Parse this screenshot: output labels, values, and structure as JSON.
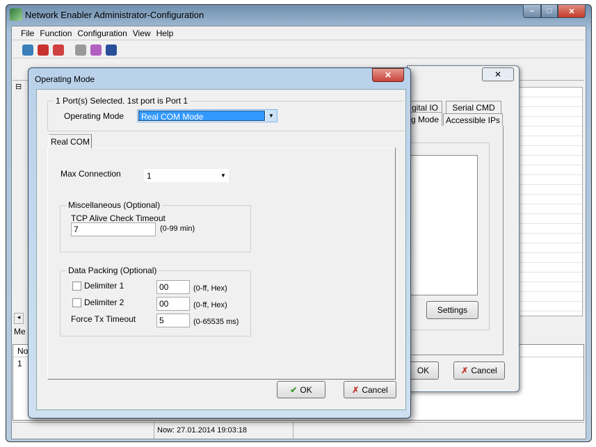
{
  "main_window": {
    "title": "Network Enabler Administrator-Configuration",
    "menu": [
      "File",
      "Function",
      "Configuration",
      "View",
      "Help"
    ],
    "toolbar_icons": [
      "broadcast-search-icon",
      "search-ip-icon",
      "unlock-icon",
      "monitor-icon",
      "book-icon",
      "exit-icon"
    ],
    "tree_toggle": "⊟",
    "bottom_tab": "Me",
    "bottom_header": "No",
    "bottom_row": "1",
    "status": "Now: 27.01.2014 19:03:18"
  },
  "background_dialog": {
    "tabs": [
      "gital IO",
      "Serial CMD",
      "g Mode",
      "Accessible IPs"
    ],
    "settings": "Settings",
    "ok": "OK",
    "cancel": "Cancel",
    "close": "✕"
  },
  "dialog": {
    "title": "Operating Mode",
    "close": "✕",
    "port_group": "1 Port(s) Selected. 1st port is Port 1",
    "operating_mode_label": "Operating Mode",
    "operating_mode_value": "Real COM Mode",
    "tab": "Real COM",
    "max_connection_label": "Max Connection",
    "max_connection_value": "1",
    "misc_group": "Miscellaneous (Optional)",
    "tcp_label": "TCP Alive Check Timeout",
    "tcp_value": "7",
    "tcp_range": "(0-99 min)",
    "packing_group": "Data Packing (Optional)",
    "delim1_label": "Delimiter 1",
    "delim1_value": "00",
    "delim1_range": "(0-ff, Hex)",
    "delim1_checked": false,
    "delim2_label": "Delimiter 2",
    "delim2_value": "00",
    "delim2_range": "(0-ff, Hex)",
    "delim2_checked": false,
    "force_label": "Force Tx Timeout",
    "force_value": "5",
    "force_range": "(0-65535 ms)",
    "ok": "OK",
    "cancel": "Cancel"
  },
  "colors": {
    "selection": "#3399ff",
    "close_red": "#c7423a",
    "ok_green": "#3a9a2a",
    "cancel_red": "#c0392b"
  }
}
